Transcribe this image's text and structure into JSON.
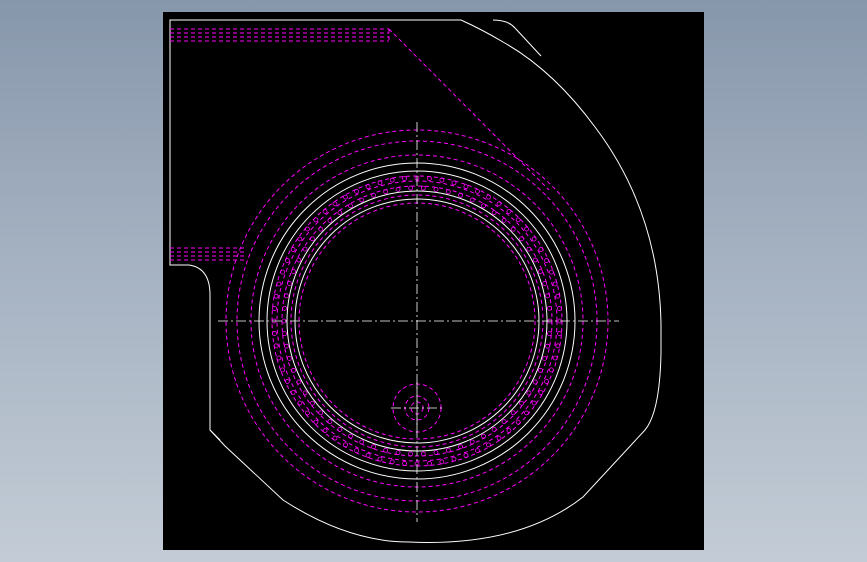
{
  "viewer": {
    "background": "#000000",
    "page_background": "#9aa8b8"
  },
  "drawing": {
    "description_visible_text": "",
    "layers": [
      {
        "name": "outline",
        "color": "#ffffff",
        "linetype": "continuous"
      },
      {
        "name": "hidden",
        "color": "#ff00ff",
        "linetype": "dashed"
      },
      {
        "name": "center",
        "color": "#ffffff",
        "linetype": "dash-dot"
      }
    ]
  }
}
